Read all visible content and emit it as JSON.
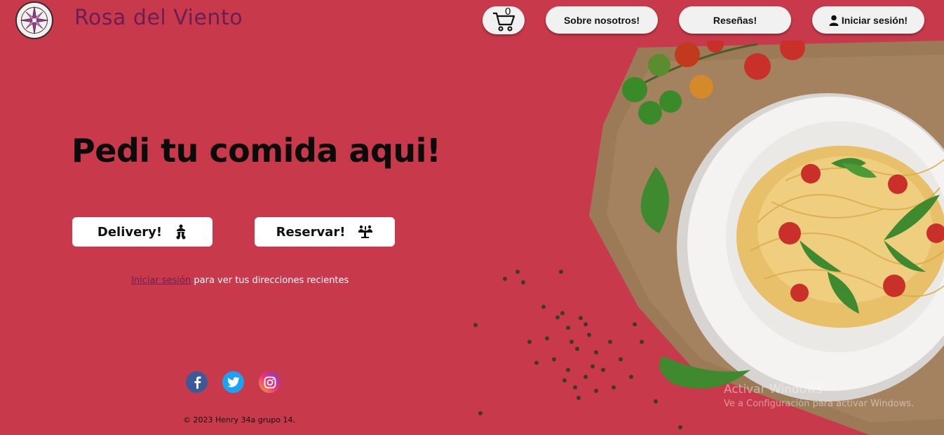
{
  "header": {
    "brand": "Rosa del Viento",
    "cart_count": "0",
    "nav": {
      "about": "Sobre nosotros!",
      "reviews": "Reseñas!",
      "login": "Iniciar sesión!"
    }
  },
  "hero": {
    "title": "Pedi tu comida aqui!",
    "delivery_label": "Delivery!",
    "reserve_label": "Reservar!",
    "login_link": "Iniciar sesión",
    "login_hint": " para ver tus direcciones recientes"
  },
  "footer": {
    "social": [
      "facebook-icon",
      "twitter-icon",
      "instagram-icon"
    ],
    "copyright": "© 2023 Henry 34a grupo 14."
  },
  "watermark": {
    "title": "Activar Windows",
    "subtitle": "Ve a Configuración para activar Windows."
  },
  "colors": {
    "background": "#c83a4b",
    "brand": "#6b1e55",
    "button": "#f1f1f1"
  }
}
